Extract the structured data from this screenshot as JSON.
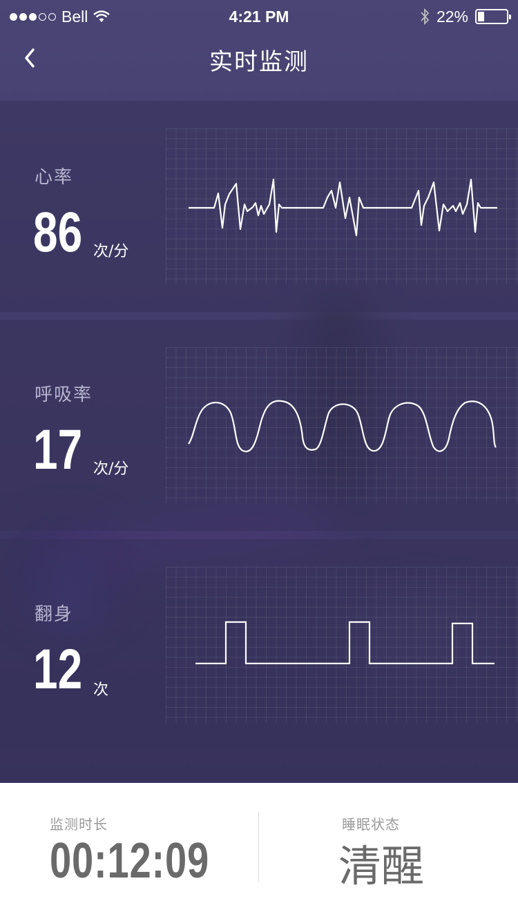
{
  "status_bar": {
    "carrier": "Bell",
    "time": "4:21 PM",
    "battery": "22%",
    "battery_level": 0.22
  },
  "nav": {
    "title": "实时监测"
  },
  "metrics": {
    "heart_rate": {
      "label": "心率",
      "value": "86",
      "unit": "次/分"
    },
    "respiration": {
      "label": "呼吸率",
      "value": "17",
      "unit": "次/分"
    },
    "turn_over": {
      "label": "翻身",
      "value": "12",
      "unit": "次"
    }
  },
  "footer": {
    "duration_label": "监测时长",
    "duration_value": "00:12:09",
    "state_label": "睡眠状态",
    "state_value": "清醒"
  },
  "colors": {
    "background": "#3d3862",
    "footer_bg": "#ffffff",
    "footer_text": "#6a6a6a"
  }
}
